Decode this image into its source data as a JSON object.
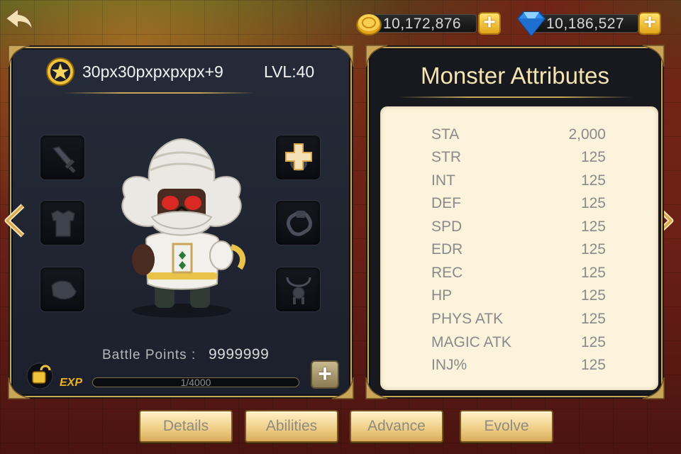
{
  "header": {
    "back_icon": "back-arrow-icon",
    "gold": {
      "icon": "gold-coin-icon",
      "value": "10,172,876"
    },
    "gems": {
      "icon": "blue-diamond-icon",
      "value": "10,186,527"
    }
  },
  "monster_panel": {
    "badge_icon": "star-badge-icon",
    "name": "30px30pxpxpxpx+9",
    "level": "LVL:40",
    "equipment_slots": {
      "left": [
        "sword-icon",
        "armor-icon",
        "boot-icon"
      ],
      "right": [
        "add-slot-icon",
        "ring-icon",
        "necklace-icon"
      ]
    },
    "battle_points_label": "Battle Points :",
    "battle_points_value": "9999999",
    "exp_label": "EXP",
    "exp_text": "1/4000",
    "exp_fraction": 0.00025
  },
  "attributes": {
    "title": "Monster Attributes",
    "rows": [
      {
        "key": "STA",
        "value": "2,000"
      },
      {
        "key": "STR",
        "value": "125"
      },
      {
        "key": "INT",
        "value": "125"
      },
      {
        "key": "DEF",
        "value": "125"
      },
      {
        "key": "SPD",
        "value": "125"
      },
      {
        "key": "EDR",
        "value": "125"
      },
      {
        "key": "REC",
        "value": "125"
      },
      {
        "key": "HP",
        "value": "125"
      },
      {
        "key": "PHYS ATK",
        "value": "125"
      },
      {
        "key": "MAGIC ATK",
        "value": "125"
      },
      {
        "key": "INJ%",
        "value": "125"
      }
    ]
  },
  "tabs": [
    {
      "label": "Details"
    },
    {
      "label": "Abilities"
    },
    {
      "label": "Advance"
    },
    {
      "label": "Evolve"
    }
  ],
  "colors": {
    "gold_border": "#c9a55a",
    "exp_label": "#f0b21a",
    "attr_title": "#f5e4b2",
    "attr_box_bg": "#fcf3dc"
  }
}
